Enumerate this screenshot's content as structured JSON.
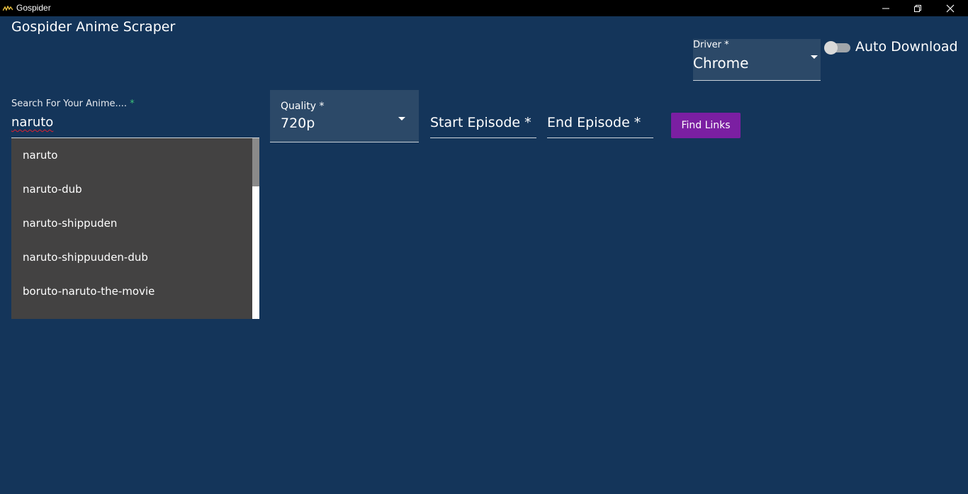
{
  "window": {
    "title": "Gospider",
    "icon": "app-logo-icon",
    "controls": [
      "minimize-icon",
      "maximize-icon",
      "close-icon"
    ]
  },
  "app": {
    "title": "Gospider Anime Scraper"
  },
  "driver": {
    "label": "Driver *",
    "value": "Chrome"
  },
  "auto_download": {
    "label": "Auto Download",
    "enabled": false
  },
  "search": {
    "label": "Search For Your Anime....",
    "required_marker": "*",
    "value": "naruto",
    "suggestions": [
      "naruto",
      "naruto-dub",
      "naruto-shippuden",
      "naruto-shippuuden-dub",
      "boruto-naruto-the-movie"
    ]
  },
  "quality": {
    "label": "Quality *",
    "value": "720p"
  },
  "episodes": {
    "start_label": "Start Episode *",
    "end_label": "End Episode *"
  },
  "actions": {
    "find_links": "Find Links"
  },
  "colors": {
    "background": "#14355a",
    "field_background": "#2c4968",
    "dropdown_background": "#434242",
    "button": "#7b1fa2"
  }
}
